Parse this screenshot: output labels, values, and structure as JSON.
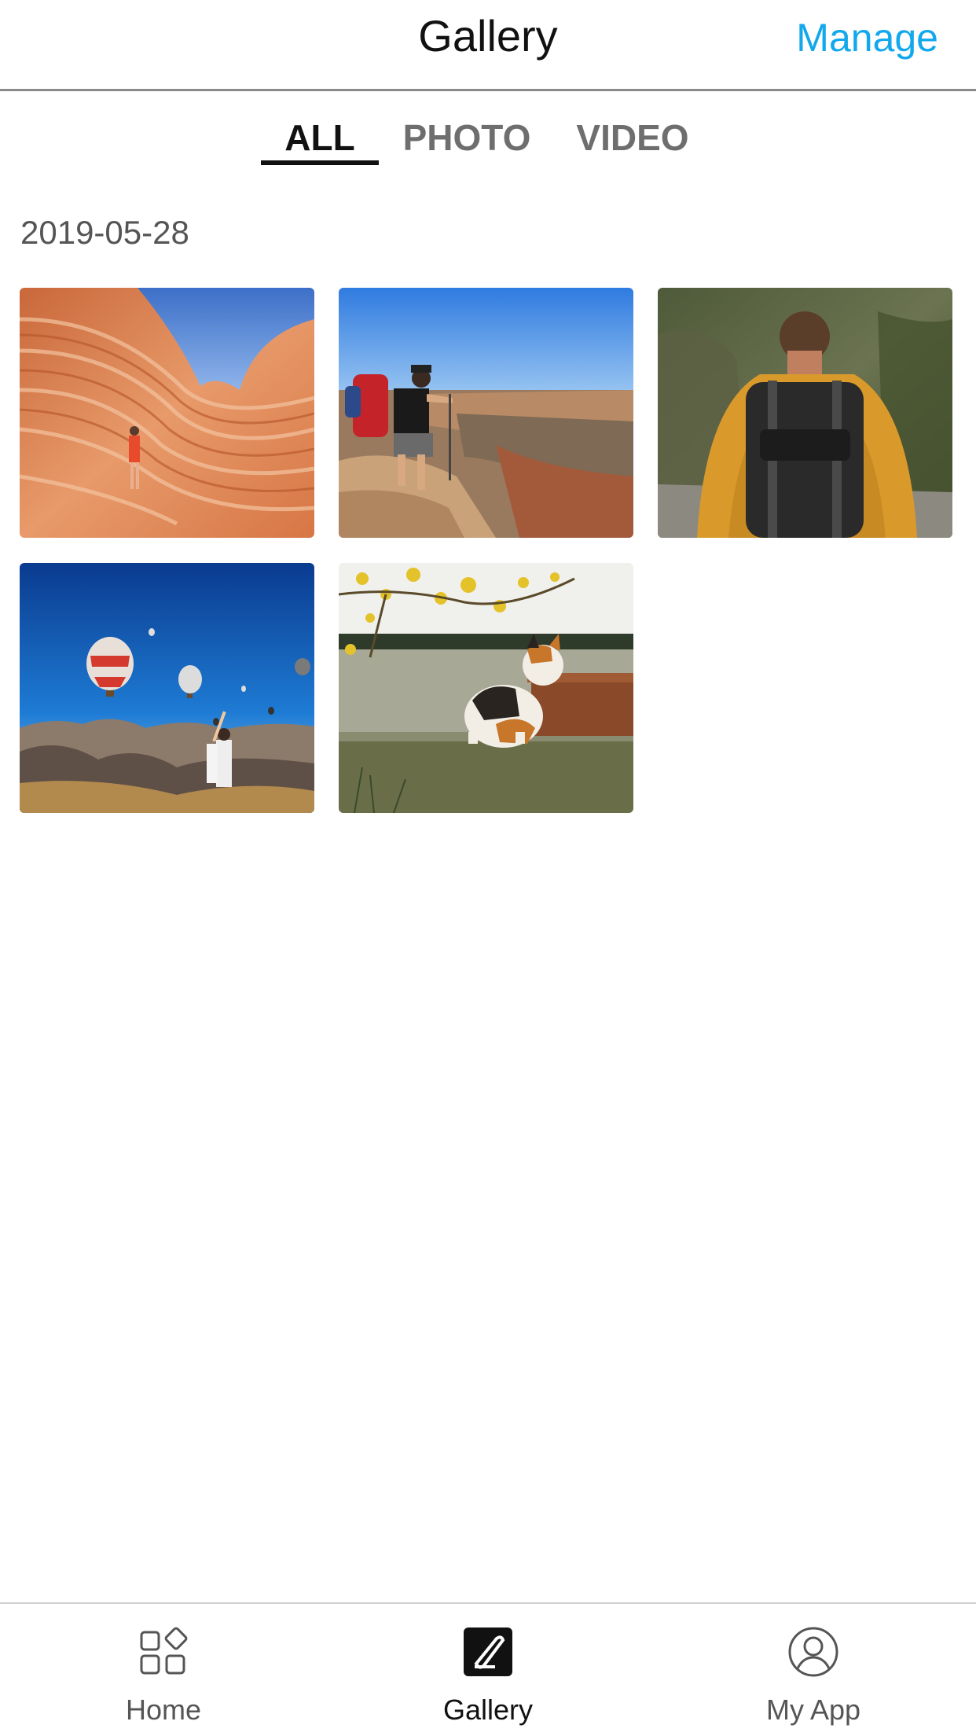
{
  "header": {
    "title": "Gallery",
    "action_label": "Manage",
    "action_color": "#12a8ec"
  },
  "tabs": [
    {
      "label": "ALL",
      "active": true
    },
    {
      "label": "PHOTO",
      "active": false
    },
    {
      "label": "VIDEO",
      "active": false
    }
  ],
  "date_group": {
    "date": "2019-05-28",
    "items": [
      {
        "type": "photo",
        "subject": "orange sandstone canyon with hiker"
      },
      {
        "type": "photo",
        "subject": "hiker with red backpack overlooking canyon"
      },
      {
        "type": "photo",
        "subject": "man in yellow jacket with black backpack"
      },
      {
        "type": "photo",
        "subject": "hot air balloons over rocky valley"
      },
      {
        "type": "photo",
        "subject": "calico cat on stone wall"
      }
    ]
  },
  "bottom_nav": [
    {
      "label": "Home",
      "icon": "home-grid-icon",
      "active": false
    },
    {
      "label": "Gallery",
      "icon": "gallery-edit-icon",
      "active": true
    },
    {
      "label": "My App",
      "icon": "user-circle-icon",
      "active": false
    }
  ]
}
